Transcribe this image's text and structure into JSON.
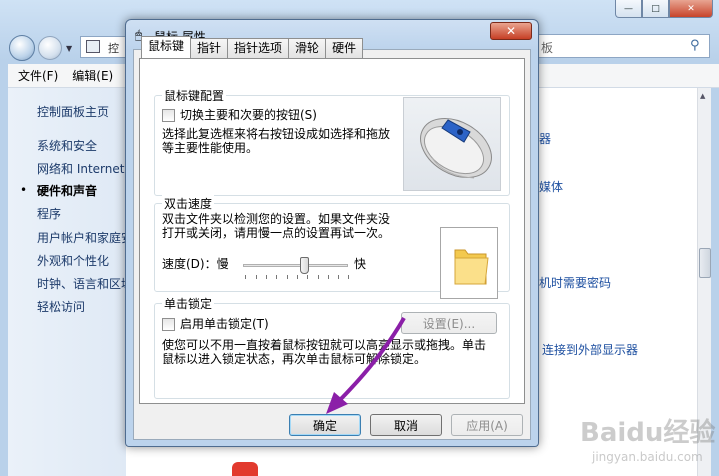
{
  "background_window": {
    "menu": [
      "文件(F)",
      "编辑(E)"
    ],
    "address_partial": "控",
    "search_placeholder_partial": "板",
    "sidebar": [
      {
        "label": "控制面板主页",
        "current": false
      },
      {
        "label": "系统和安全",
        "current": false
      },
      {
        "label": "网络和 Internet",
        "current": false
      },
      {
        "label": "硬件和声音",
        "current": true
      },
      {
        "label": "程序",
        "current": false
      },
      {
        "label": "用户帐户和家庭安全",
        "current": false
      },
      {
        "label": "外观和个性化",
        "current": false
      },
      {
        "label": "时钟、语言和区域",
        "current": false
      },
      {
        "label": "轻松访问",
        "current": false
      }
    ],
    "right_links": [
      "器",
      "媒体",
      "机时需要密码",
      "连接到外部显示器"
    ]
  },
  "dialog": {
    "title": "鼠标 属性",
    "tabs": [
      "鼠标键",
      "指针",
      "指针选项",
      "滑轮",
      "硬件"
    ],
    "active_tab": "鼠标键",
    "button_config": {
      "title": "鼠标键配置",
      "switch_label": "切换主要和次要的按钮(S)",
      "description": "选择此复选框来将右按钮设成如选择和拖放等主要性能使用。"
    },
    "double_click": {
      "title": "双击速度",
      "description": "双击文件夹以检测您的设置。如果文件夹没打开或关闭，请用慢一点的设置再试一次。",
      "speed_label": "速度(D)：慢",
      "fast_label": "快",
      "speed_value": 6,
      "speed_max": 10
    },
    "click_lock": {
      "title": "单击锁定",
      "enable_label": "启用单击锁定(T)",
      "settings_button": "设置(E)...",
      "description": "使您可以不用一直按着鼠标按钮就可以高亮显示或拖拽。单击鼠标以进入锁定状态，再次单击鼠标可解除锁定。"
    },
    "buttons": {
      "ok": "确定",
      "cancel": "取消",
      "apply": "应用(A)"
    }
  },
  "watermark": {
    "logo": "Baidu经验",
    "sub": "jingyan.baidu.com"
  }
}
